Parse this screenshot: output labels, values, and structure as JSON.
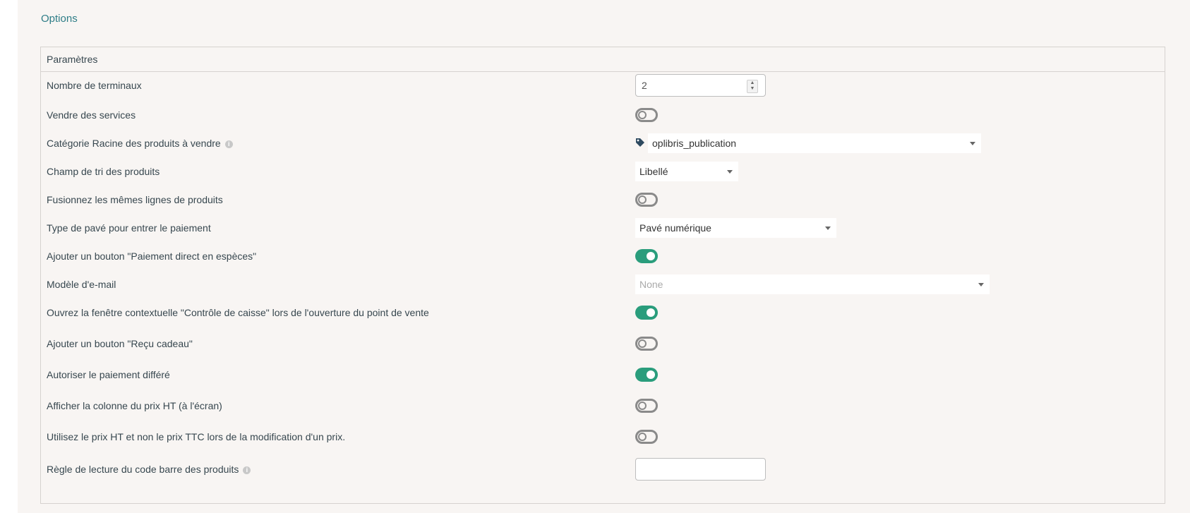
{
  "header": {
    "options_label": "Options"
  },
  "panel": {
    "title": "Paramètres",
    "rows": {
      "terminals": {
        "label": "Nombre de terminaux",
        "value": "2"
      },
      "sell_services": {
        "label": "Vendre des services",
        "checked": false
      },
      "root_category": {
        "label": "Catégorie Racine des produits à vendre",
        "value": "oplibris_publication",
        "icon": "tag-icon",
        "info_icon": "i"
      },
      "sort_field": {
        "label": "Champ de tri des produits",
        "value": "Libellé"
      },
      "merge_lines": {
        "label": "Fusionnez les mêmes lignes de produits",
        "checked": false
      },
      "payment_pad": {
        "label": "Type de pavé pour entrer le paiement",
        "value": "Pavé numérique"
      },
      "direct_cash": {
        "label": "Ajouter un bouton \"Paiement direct en espèces\"",
        "checked": true
      },
      "email_template": {
        "label": "Modèle d'e-mail",
        "value": "None"
      },
      "cash_control": {
        "label": "Ouvrez la fenêtre contextuelle \"Contrôle de caisse\" lors de l'ouverture du point de vente",
        "checked": true
      },
      "gift_receipt": {
        "label": "Ajouter un bouton \"Reçu cadeau\"",
        "checked": false
      },
      "deferred_payment": {
        "label": "Autoriser le paiement différé",
        "checked": true
      },
      "show_ht_column": {
        "label": "Afficher la colonne du prix HT (à l'écran)",
        "checked": false
      },
      "use_ht_price": {
        "label": "Utilisez le prix HT et non le prix TTC lors de la modification d'un prix.",
        "checked": false
      },
      "barcode_rule": {
        "label": "Règle de lecture du code barre des produits",
        "value": "",
        "info_icon": "i"
      }
    }
  },
  "colors": {
    "accent": "#2a9d7c",
    "link": "#2e7d87",
    "background": "#f8f5f3"
  }
}
